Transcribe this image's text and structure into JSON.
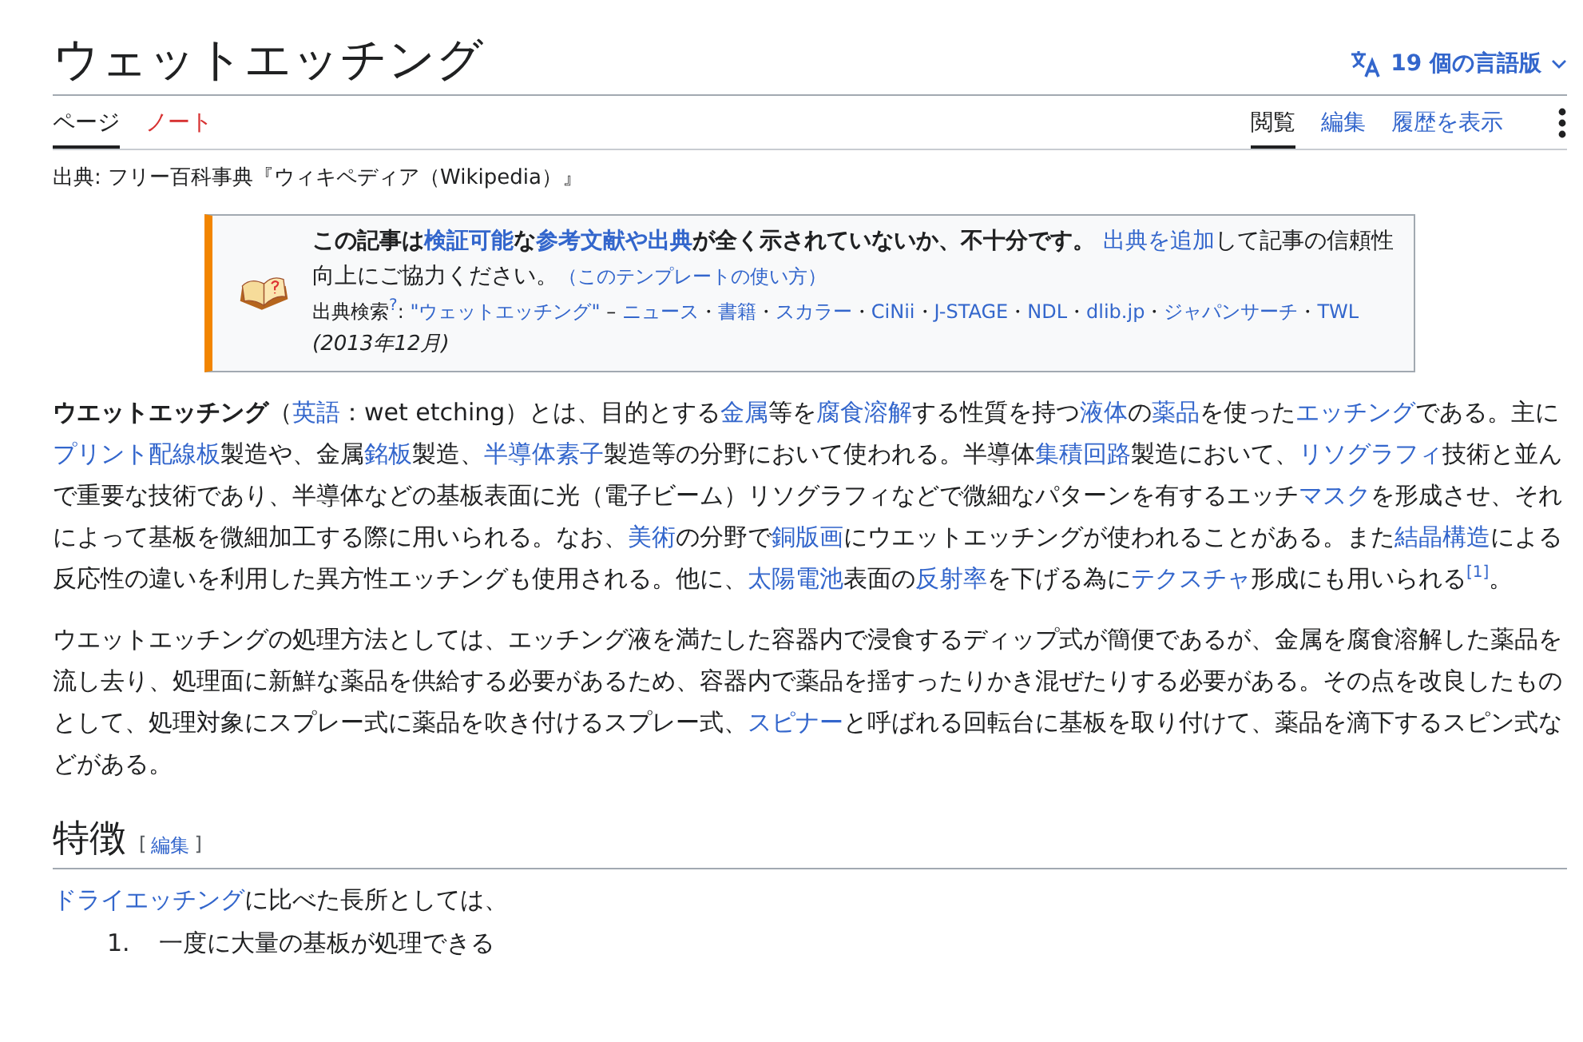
{
  "title": "ウェットエッチング",
  "languages": {
    "label": "19 個の言語版"
  },
  "left_tabs": [
    {
      "label": "ページ",
      "selected": true,
      "missing": false
    },
    {
      "label": "ノート",
      "selected": false,
      "missing": true
    }
  ],
  "right_tabs": [
    {
      "label": "閲覧",
      "selected": true
    },
    {
      "label": "編集",
      "selected": false
    },
    {
      "label": "履歴を表示",
      "selected": false
    }
  ],
  "source_line": "出典: フリー百科事典『ウィキペディア（Wikipedia）』",
  "notice": {
    "message": [
      {
        "kind": "bold",
        "t": "この記事は"
      },
      {
        "kind": "bold_link",
        "t": "検証可能"
      },
      {
        "kind": "bold",
        "t": "な"
      },
      {
        "kind": "bold_link",
        "t": "参考文献や出典"
      },
      {
        "kind": "bold",
        "t": "が全く示されていないか、不十分です。 "
      },
      {
        "kind": "link",
        "t": "出典を追加"
      },
      {
        "kind": "text",
        "t": "して記事の信頼性向上にご協力ください。"
      },
      {
        "kind": "small_link",
        "t": "（このテンプレートの使い方）"
      }
    ],
    "search": [
      {
        "kind": "text",
        "t": "出典検索"
      },
      {
        "kind": "ref",
        "t": "?"
      },
      {
        "kind": "text",
        "t": ": "
      },
      {
        "kind": "link",
        "t": "\"ウェットエッチング\""
      },
      {
        "kind": "text",
        "t": " – "
      },
      {
        "kind": "link",
        "t": "ニュース"
      },
      {
        "kind": "text",
        "t": "・"
      },
      {
        "kind": "link",
        "t": "書籍"
      },
      {
        "kind": "text",
        "t": "・"
      },
      {
        "kind": "link",
        "t": "スカラー"
      },
      {
        "kind": "text",
        "t": "・"
      },
      {
        "kind": "link",
        "t": "CiNii"
      },
      {
        "kind": "text",
        "t": "・"
      },
      {
        "kind": "link",
        "t": "J-STAGE"
      },
      {
        "kind": "text",
        "t": "・"
      },
      {
        "kind": "link",
        "t": "NDL"
      },
      {
        "kind": "text",
        "t": "・"
      },
      {
        "kind": "link",
        "t": "dlib.jp"
      },
      {
        "kind": "text",
        "t": "・"
      },
      {
        "kind": "link",
        "t": "ジャパンサーチ"
      },
      {
        "kind": "text",
        "t": "・"
      },
      {
        "kind": "link",
        "t": "TWL"
      }
    ],
    "date": "(2013年12月)"
  },
  "paragraphs": [
    [
      {
        "kind": "bold",
        "t": "ウエットエッチング"
      },
      {
        "kind": "text",
        "t": "（"
      },
      {
        "kind": "link",
        "t": "英語"
      },
      {
        "kind": "text",
        "t": "：wet etching）とは、目的とする"
      },
      {
        "kind": "link",
        "t": "金属"
      },
      {
        "kind": "text",
        "t": "等を"
      },
      {
        "kind": "link",
        "t": "腐食溶解"
      },
      {
        "kind": "text",
        "t": "する性質を持つ"
      },
      {
        "kind": "link",
        "t": "液体"
      },
      {
        "kind": "text",
        "t": "の"
      },
      {
        "kind": "link",
        "t": "薬品"
      },
      {
        "kind": "text",
        "t": "を使った"
      },
      {
        "kind": "link",
        "t": "エッチング"
      },
      {
        "kind": "text",
        "t": "である。主に"
      },
      {
        "kind": "link",
        "t": "プリント配線板"
      },
      {
        "kind": "text",
        "t": "製造や、金属"
      },
      {
        "kind": "link",
        "t": "銘板"
      },
      {
        "kind": "text",
        "t": "製造、"
      },
      {
        "kind": "link",
        "t": "半導体素子"
      },
      {
        "kind": "text",
        "t": "製造等の分野において使われる。半導体"
      },
      {
        "kind": "link",
        "t": "集積回路"
      },
      {
        "kind": "text",
        "t": "製造において、"
      },
      {
        "kind": "link",
        "t": "リソグラフィ"
      },
      {
        "kind": "text",
        "t": "技術と並んで重要な技術であり、半導体などの基板表面に光（電子ビーム）リソグラフィなどで微細なパターンを有するエッチ"
      },
      {
        "kind": "link",
        "t": "マスク"
      },
      {
        "kind": "text",
        "t": "を形成させ、それによって基板を微細加工する際に用いられる。なお、"
      },
      {
        "kind": "link",
        "t": "美術"
      },
      {
        "kind": "text",
        "t": "の分野で"
      },
      {
        "kind": "link",
        "t": "銅版画"
      },
      {
        "kind": "text",
        "t": "にウエットエッチングが使われることがある。また"
      },
      {
        "kind": "link",
        "t": "結晶構造"
      },
      {
        "kind": "text",
        "t": "による反応性の違いを利用した異方性エッチングも使用される。他に、"
      },
      {
        "kind": "link",
        "t": "太陽電池"
      },
      {
        "kind": "text",
        "t": "表面の"
      },
      {
        "kind": "link",
        "t": "反射率"
      },
      {
        "kind": "text",
        "t": "を下げる為に"
      },
      {
        "kind": "link",
        "t": "テクスチャ"
      },
      {
        "kind": "text",
        "t": "形成にも用いられる"
      },
      {
        "kind": "ref",
        "t": "[1]"
      },
      {
        "kind": "text",
        "t": "。"
      }
    ],
    [
      {
        "kind": "text",
        "t": "ウエットエッチングの処理方法としては、エッチング液を満たした容器内で浸食するディップ式が簡便であるが、金属を腐食溶解した薬品を流し去り、処理面に新鮮な薬品を供給する必要があるため、容器内で薬品を揺すったりかき混ぜたりする必要がある。その点を改良したものとして、処理対象にスプレー式に薬品を吹き付けるスプレー式、"
      },
      {
        "kind": "link",
        "t": "スピナー"
      },
      {
        "kind": "text",
        "t": "と呼ばれる回転台に基板を取り付けて、薬品を滴下するスピン式などがある。"
      }
    ]
  ],
  "section": {
    "heading": "特徴",
    "edit_open": "[",
    "edit": "編集",
    "edit_close": "]",
    "intro": [
      {
        "kind": "link",
        "t": "ドライエッチング"
      },
      {
        "kind": "text",
        "t": "に比べた長所としては、"
      }
    ],
    "list": [
      {
        "number": "1.",
        "text": "一度に大量の基板が処理できる"
      }
    ]
  }
}
